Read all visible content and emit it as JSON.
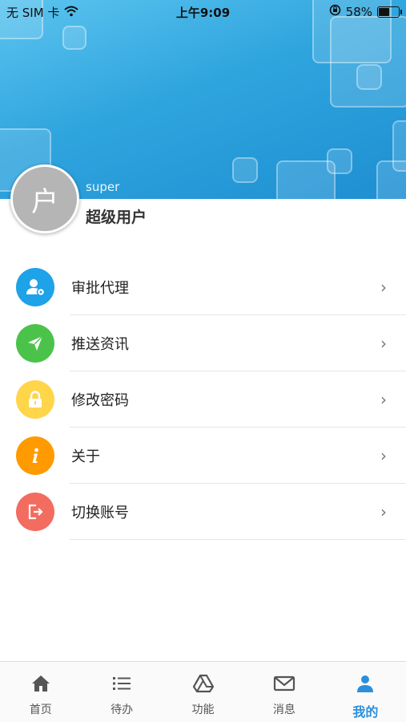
{
  "status_bar": {
    "carrier": "无 SIM 卡",
    "time": "上午9:09",
    "battery": "58%",
    "battery_level": 0.58
  },
  "profile": {
    "avatar_char": "户",
    "username": "super",
    "role": "超级用户"
  },
  "menu": [
    {
      "label": "审批代理",
      "icon": "user-proxy-icon",
      "color": "#1ea2e8"
    },
    {
      "label": "推送资讯",
      "icon": "send-icon",
      "color": "#4bc34a"
    },
    {
      "label": "修改密码",
      "icon": "lock-icon",
      "color": "#ffd54a"
    },
    {
      "label": "关于",
      "icon": "info-icon",
      "color": "#ff9a00"
    },
    {
      "label": "切换账号",
      "icon": "logout-icon",
      "color": "#f36c60"
    }
  ],
  "chevron": "›",
  "tabbar": {
    "tabs": [
      {
        "label": "首页",
        "icon": "home-icon"
      },
      {
        "label": "待办",
        "icon": "list-icon"
      },
      {
        "label": "功能",
        "icon": "drive-icon"
      },
      {
        "label": "消息",
        "icon": "mail-icon"
      },
      {
        "label": "我的",
        "icon": "person-icon",
        "active": true
      }
    ],
    "active_color": "#2b8fdc"
  }
}
